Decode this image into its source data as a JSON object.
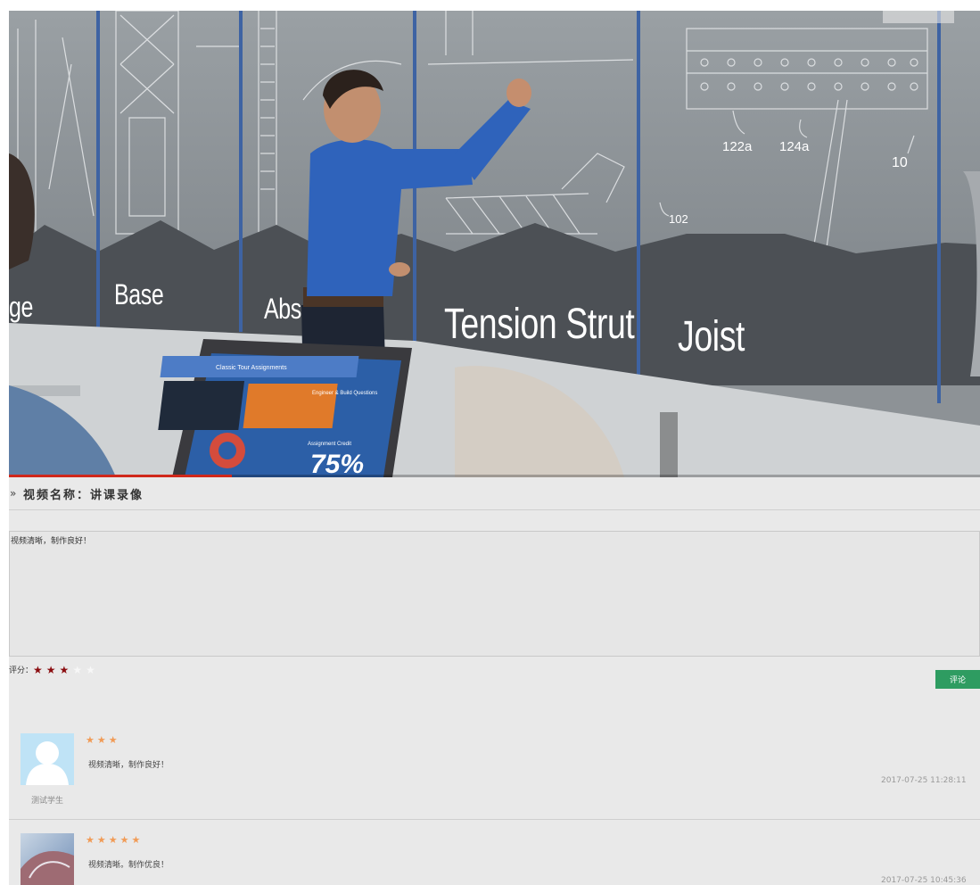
{
  "video": {
    "labels": [
      "ge",
      "Base",
      "Abs",
      "Tension Strut",
      "Joist"
    ],
    "callouts": [
      "122a",
      "124a",
      "10",
      "102"
    ],
    "laptop_header": "Classic Tour Assignments",
    "laptop_card_1": "Engineer & Build Questions",
    "laptop_card_2": "Assignment Credit",
    "laptop_percent": "75%",
    "progress_fraction": 0.23,
    "progress_color": "#d0281b"
  },
  "title": {
    "chevron": "»",
    "text": "视频名称：讲课录像"
  },
  "form": {
    "comment_value": "视频清晰，制作良好！",
    "rating_label": "评分：",
    "rating": 3,
    "max_rating": 5,
    "submit_label": "评论",
    "submit_color": "#2e9c61"
  },
  "comments": [
    {
      "username": "测试学生",
      "stars": 3,
      "text": "视频清晰，制作良好！",
      "time": "2017-07-25 11:28:11",
      "avatar": "default-user-icon"
    },
    {
      "username": "",
      "stars": 5,
      "text": "视频清晰。制作优良！",
      "time": "2017-07-25 10:45:36",
      "avatar": "photo-avatar"
    }
  ]
}
